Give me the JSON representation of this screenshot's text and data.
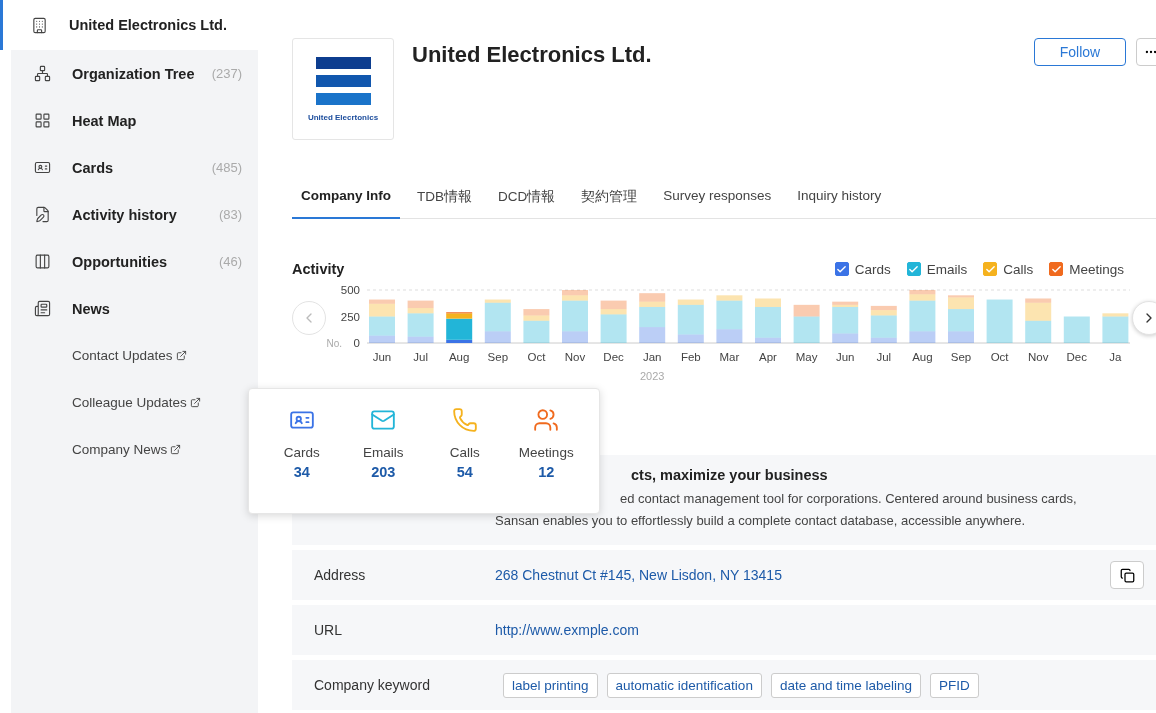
{
  "sidebar": {
    "items": [
      {
        "kind": "main",
        "label": "United Electronics Ltd.",
        "selected": true
      },
      {
        "kind": "main",
        "label": "Organization Tree",
        "count": "(237)",
        "selected": false
      },
      {
        "kind": "main",
        "label": "Heat Map",
        "selected": false
      },
      {
        "kind": "main",
        "label": "Cards",
        "count": "(485)",
        "selected": false
      },
      {
        "kind": "main",
        "label": "Activity history",
        "count": "(83)",
        "selected": false
      },
      {
        "kind": "main",
        "label": "Opportunities",
        "count": "(46)",
        "selected": false
      },
      {
        "kind": "main",
        "label": "News",
        "selected": false
      },
      {
        "kind": "link",
        "label": "Contact Updates",
        "selected": false
      },
      {
        "kind": "link",
        "label": "Colleague Updates",
        "selected": false
      },
      {
        "kind": "link",
        "label": "Company News",
        "selected": false
      }
    ]
  },
  "header": {
    "logo_text": "United Elecrtonics",
    "title": "United Electronics Ltd.",
    "follow_button": "Follow"
  },
  "tabs": [
    {
      "label": "Company Info",
      "selected": true
    },
    {
      "label": "TDB情報",
      "selected": false
    },
    {
      "label": "DCD情報",
      "selected": false
    },
    {
      "label": "契約管理",
      "selected": false
    },
    {
      "label": "Survey responses",
      "selected": false
    },
    {
      "label": "Inquiry history",
      "selected": false
    }
  ],
  "activity": {
    "title": "Activity",
    "legend": [
      {
        "checked": true
      },
      {
        "checked": true
      },
      {
        "checked": true
      },
      {
        "checked": true
      }
    ],
    "bars": [
      {
        "selected": false
      },
      {
        "selected": false
      },
      {
        "selected": true
      },
      {
        "selected": false
      },
      {
        "selected": false
      },
      {
        "selected": false
      },
      {
        "selected": false
      },
      {
        "selected": false
      },
      {
        "selected": false
      },
      {
        "selected": false
      },
      {
        "selected": false
      },
      {
        "selected": false
      },
      {
        "selected": false
      },
      {
        "selected": false
      },
      {
        "selected": false
      },
      {
        "selected": false
      },
      {
        "selected": false
      },
      {
        "selected": false
      },
      {
        "selected": false
      },
      {
        "selected": false
      }
    ],
    "chart_data": {
      "type": "bar",
      "stacked": true,
      "ylabel": "No.",
      "yticks": [
        0,
        250,
        500
      ],
      "ylim": [
        0,
        500
      ],
      "categories": [
        "Jun",
        "Jul",
        "Aug",
        "Sep",
        "Oct",
        "Nov",
        "Dec",
        "Jan",
        "Feb",
        "Mar",
        "Apr",
        "May",
        "Jun",
        "Jul",
        "Aug",
        "Sep",
        "Oct",
        "Nov",
        "Dec",
        "Ja"
      ],
      "series": [
        {
          "name": "Cards",
          "color": "#3b73e6",
          "values": [
            70,
            60,
            30,
            110,
            0,
            110,
            0,
            150,
            80,
            130,
            50,
            0,
            90,
            50,
            110,
            110,
            0,
            0,
            0,
            0
          ]
        },
        {
          "name": "Emails",
          "color": "#22b5d8",
          "values": [
            180,
            220,
            200,
            270,
            210,
            290,
            270,
            190,
            280,
            270,
            290,
            250,
            250,
            210,
            290,
            210,
            410,
            210,
            250,
            250
          ]
        },
        {
          "name": "Calls",
          "color": "#f5b21e",
          "values": [
            120,
            50,
            50,
            30,
            50,
            50,
            50,
            50,
            50,
            50,
            80,
            0,
            20,
            50,
            60,
            110,
            0,
            170,
            0,
            30
          ]
        },
        {
          "name": "Meetings",
          "color": "#f06a1e",
          "values": [
            40,
            70,
            10,
            0,
            60,
            50,
            80,
            80,
            0,
            0,
            0,
            110,
            30,
            40,
            40,
            20,
            0,
            40,
            0,
            0
          ]
        }
      ],
      "xlabel": null
    },
    "year_label": "2023",
    "tooltip": [
      {
        "kind": "card",
        "label": "Cards",
        "value": "34"
      },
      {
        "kind": "email",
        "label": "Emails",
        "value": "203"
      },
      {
        "kind": "call",
        "label": "Calls",
        "value": "54"
      },
      {
        "kind": "meeting",
        "label": "Meetings",
        "value": "12"
      }
    ]
  },
  "details": {
    "description": {
      "title": "cts, maximize your business",
      "line_1": "ed contact management tool for corporations. Centered around business cards,",
      "line_2": "Sansan enables you to effortlessly build a complete contact database, accessible anywhere."
    },
    "rows": [
      {
        "kind": "link",
        "label": "Address",
        "value": "268 Chestnut Ct #145, New Lisdon, NY 13415",
        "copy": true
      },
      {
        "kind": "link",
        "label": "URL",
        "value": "http://www.exmple.com",
        "copy": false
      },
      {
        "kind": "tags",
        "label": "Company keyword",
        "tags": [
          "label printing",
          "automatic identification",
          "date and time labeling",
          "PFID"
        ],
        "copy": false
      }
    ]
  }
}
